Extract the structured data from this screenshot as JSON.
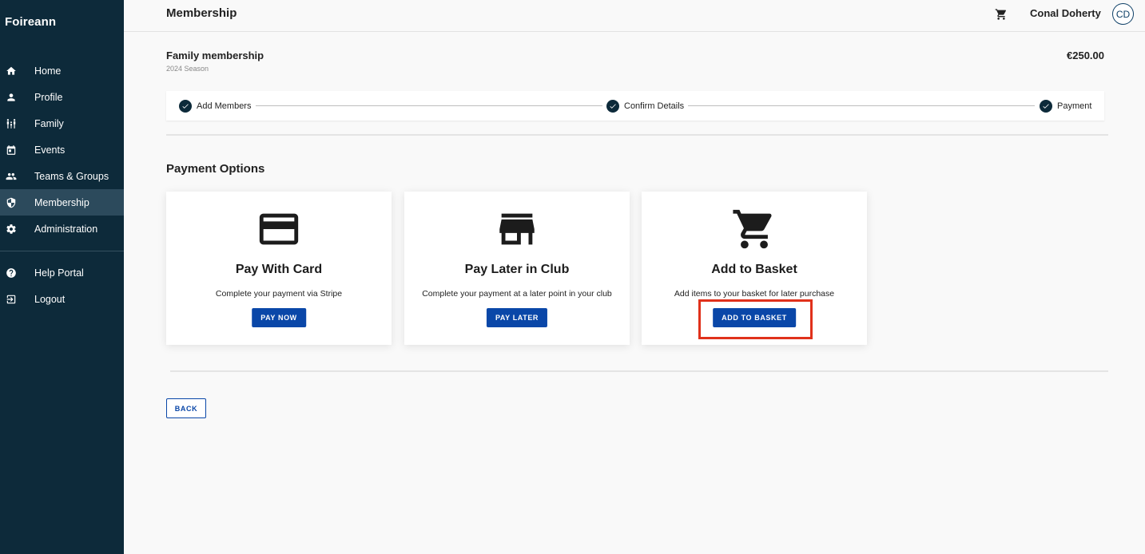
{
  "sidebar": {
    "brand": "Foireann",
    "items": [
      {
        "label": "Home",
        "icon": "home-icon"
      },
      {
        "label": "Profile",
        "icon": "person-icon"
      },
      {
        "label": "Family",
        "icon": "family-icon"
      },
      {
        "label": "Events",
        "icon": "calendar-icon"
      },
      {
        "label": "Teams & Groups",
        "icon": "group-icon"
      },
      {
        "label": "Membership",
        "icon": "shield-icon",
        "active": true
      },
      {
        "label": "Administration",
        "icon": "gear-icon"
      }
    ],
    "footer_items": [
      {
        "label": "Help Portal",
        "icon": "help-icon"
      },
      {
        "label": "Logout",
        "icon": "logout-icon"
      }
    ]
  },
  "header": {
    "title": "Membership",
    "user_name": "Conal Doherty",
    "avatar_initials": "CD",
    "cart_icon": "cart-icon"
  },
  "product": {
    "title": "Family membership",
    "season": "2024 Season",
    "price": "€250.00"
  },
  "steps": [
    {
      "label": "Add Members",
      "done": true
    },
    {
      "label": "Confirm Details",
      "done": true
    },
    {
      "label": "Payment",
      "done": true
    }
  ],
  "payment": {
    "section_title": "Payment Options",
    "options": [
      {
        "title": "Pay With Card",
        "desc": "Complete your payment via Stripe",
        "button": "PAY NOW",
        "icon": "credit-card-icon"
      },
      {
        "title": "Pay Later in Club",
        "desc": "Complete your payment at a later point in your club",
        "button": "PAY LATER",
        "icon": "store-icon"
      },
      {
        "title": "Add to Basket",
        "desc": "Add items to your basket for later purchase",
        "button": "ADD TO BASKET",
        "icon": "cart-icon"
      }
    ]
  },
  "actions": {
    "back_label": "BACK"
  },
  "colors": {
    "sidebar_bg": "#0d2a3a",
    "sidebar_active": "#2c4a5c",
    "primary_button": "#0a47a8",
    "highlight_box": "#e0311b"
  }
}
